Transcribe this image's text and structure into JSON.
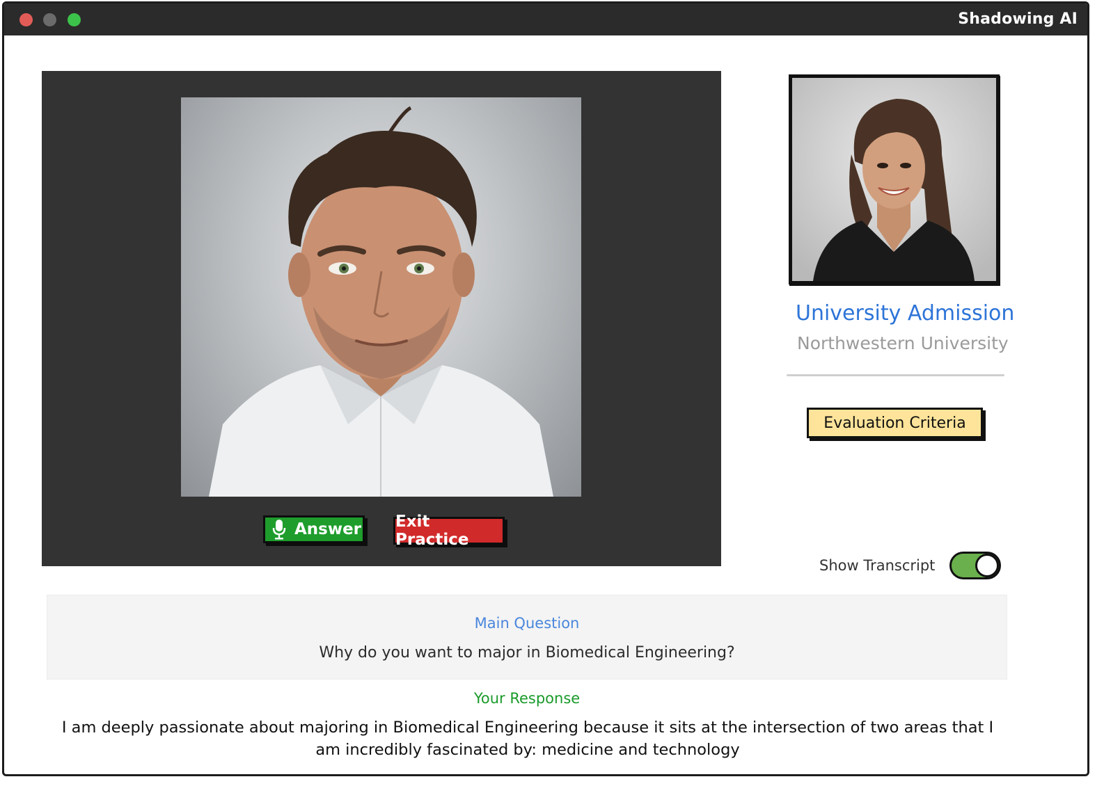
{
  "window": {
    "title": "Shadowing AI"
  },
  "video": {
    "interviewer_image": "male-interviewer-portrait",
    "answer_label": "Answer",
    "exit_label": "Exit Practice"
  },
  "interview": {
    "avatar_image": "female-candidate-portrait",
    "title": "University Admission",
    "subtitle": "Northwestern University",
    "criteria_label": "Evaluation Criteria",
    "transcript_label": "Show Transcript",
    "transcript_on": true
  },
  "question": {
    "label": "Main Question",
    "text": "Why do you want to major in Biomedical Engineering?"
  },
  "response": {
    "label": "Your Response",
    "text": "I am deeply passionate about majoring in Biomedical Engineering because it sits at the intersection of two areas that I am incredibly fascinated by: medicine and technology"
  },
  "colors": {
    "answer_green": "#1e9d2c",
    "exit_red": "#d12a2a",
    "title_blue": "#2d74d8",
    "criteria_yellow": "#fde49a",
    "toggle_green": "#6ab04c",
    "response_green": "#1a9a2a"
  }
}
